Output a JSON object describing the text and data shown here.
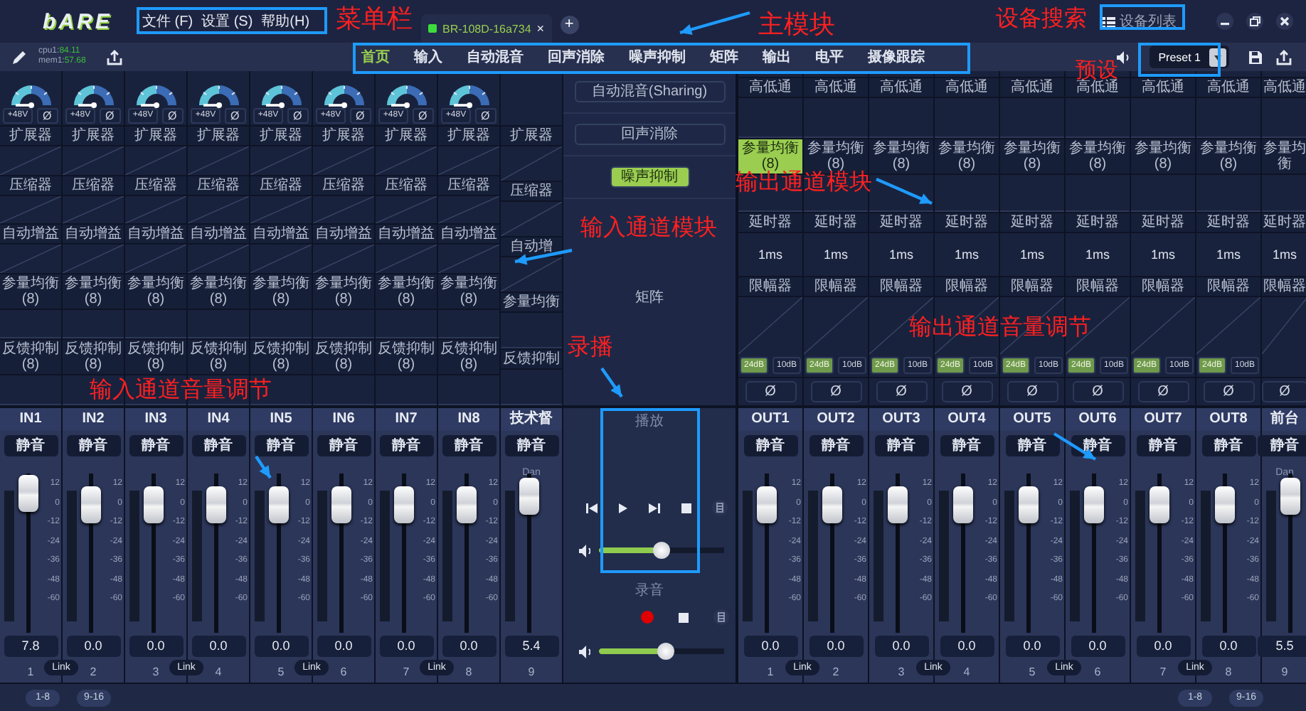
{
  "title_bar": {
    "logo": "bARE",
    "menu": [
      "文件 (F)",
      "设置 (S)",
      "帮助(H)"
    ],
    "device_tab": {
      "name": "BR-108D-16a734",
      "close": "×"
    },
    "add_tab": "+",
    "device_list": "设备列表"
  },
  "toolbar": {
    "cpu": {
      "label": "cpu1:",
      "value": "84.11"
    },
    "mem": {
      "label": "mem1:",
      "value": "57.68"
    },
    "nav": [
      {
        "label": "首页",
        "selected": true
      },
      {
        "label": "输入",
        "selected": false
      },
      {
        "label": "自动混音",
        "selected": false
      },
      {
        "label": "回声消除",
        "selected": false
      },
      {
        "label": "噪声抑制",
        "selected": false
      },
      {
        "label": "矩阵",
        "selected": false
      },
      {
        "label": "输出",
        "selected": false
      },
      {
        "label": "电平",
        "selected": false
      },
      {
        "label": "摄像跟踪",
        "selected": false
      }
    ],
    "preset": "Preset 1"
  },
  "inputs": [
    {
      "name": "IN1",
      "knob": true,
      "phantom": "+48V",
      "phantom_on": false,
      "phase": "Ø",
      "modules": [
        "扩展器",
        "压缩器",
        "自动增益",
        "参量均衡(8)",
        "反馈抑制(8)"
      ],
      "mute": "静音",
      "muted": false,
      "scale": [
        "12",
        "0",
        "-12",
        "-24",
        "-36",
        "-48",
        "-60"
      ],
      "level": 0.99,
      "value": "7.8",
      "number": "1",
      "link": "Link"
    },
    {
      "name": "IN2",
      "knob": true,
      "phantom": "+48V",
      "phantom_on": false,
      "phase": "Ø",
      "modules": [
        "扩展器",
        "压缩器",
        "自动增益",
        "参量均衡(8)",
        "反馈抑制(8)"
      ],
      "mute": "静音",
      "muted": false,
      "scale": [
        "12",
        "0",
        "-12",
        "-24",
        "-36",
        "-48",
        "-60"
      ],
      "level": 0.9,
      "value": "0.0",
      "number": "2"
    },
    {
      "name": "IN3",
      "knob": true,
      "phantom": "+48V",
      "phantom_on": false,
      "phase": "Ø",
      "modules": [
        "扩展器",
        "压缩器",
        "自动增益",
        "参量均衡(8)",
        "反馈抑制(8)"
      ],
      "mute": "静音",
      "muted": false,
      "scale": [
        "12",
        "0",
        "-12",
        "-24",
        "-36",
        "-48",
        "-60"
      ],
      "level": 0.9,
      "value": "0.0",
      "number": "3",
      "link": "Link"
    },
    {
      "name": "IN4",
      "knob": true,
      "phantom": "+48V",
      "phantom_on": false,
      "phase": "Ø",
      "modules": [
        "扩展器",
        "压缩器",
        "自动增益",
        "参量均衡(8)",
        "反馈抑制(8)"
      ],
      "mute": "静音",
      "muted": false,
      "scale": [
        "12",
        "0",
        "-12",
        "-24",
        "-36",
        "-48",
        "-60"
      ],
      "level": 0.9,
      "value": "0.0",
      "number": "4"
    },
    {
      "name": "IN5",
      "knob": true,
      "phantom": "+48V",
      "phantom_on": false,
      "phase": "Ø",
      "modules": [
        "扩展器",
        "压缩器",
        "自动增益",
        "参量均衡(8)",
        "反馈抑制(8)"
      ],
      "mute": "静音",
      "muted": false,
      "scale": [
        "12",
        "0",
        "-12",
        "-24",
        "-36",
        "-48",
        "-60"
      ],
      "level": 0.9,
      "value": "0.0",
      "number": "5",
      "link": "Link"
    },
    {
      "name": "IN6",
      "knob": true,
      "phantom": "+48V",
      "phantom_on": false,
      "phase": "Ø",
      "modules": [
        "扩展器",
        "压缩器",
        "自动增益",
        "参量均衡(8)",
        "反馈抑制(8)"
      ],
      "mute": "静音",
      "muted": false,
      "scale": [
        "12",
        "0",
        "-12",
        "-24",
        "-36",
        "-48",
        "-60"
      ],
      "level": 0.9,
      "value": "0.0",
      "number": "6"
    },
    {
      "name": "IN7",
      "knob": true,
      "phantom": "+48V",
      "phantom_on": false,
      "phase": "Ø",
      "modules": [
        "扩展器",
        "压缩器",
        "自动增益",
        "参量均衡(8)",
        "反馈抑制(8)"
      ],
      "mute": "静音",
      "muted": false,
      "scale": [
        "12",
        "0",
        "-12",
        "-24",
        "-36",
        "-48",
        "-60"
      ],
      "level": 0.9,
      "value": "0.0",
      "number": "7",
      "link": "Link"
    },
    {
      "name": "IN8",
      "knob": true,
      "phantom": "+48V",
      "phantom_on": false,
      "phase": "Ø",
      "modules": [
        "扩展器",
        "压缩器",
        "自动增益",
        "参量均衡(8)",
        "反馈抑制(8)"
      ],
      "mute": "静音",
      "muted": false,
      "scale": [
        "12",
        "0",
        "-12",
        "-24",
        "-36",
        "-48",
        "-60"
      ],
      "level": 0.9,
      "value": "0.0",
      "number": "8"
    },
    {
      "name": "技术督",
      "knob": false,
      "modules": [
        "扩展器",
        "压缩器",
        "自动增",
        "参量均衡",
        "反馈抑制"
      ],
      "mute": "静音",
      "muted": false,
      "tag": "Dan",
      "level": 0.96,
      "value": "5.4",
      "number": "9"
    }
  ],
  "center": {
    "buttons": [
      {
        "label": "自动混音(Sharing)",
        "on": false
      },
      {
        "label": "回声消除",
        "on": false
      },
      {
        "label": "噪声抑制",
        "on": true
      }
    ],
    "matrix": "矩阵",
    "playback": {
      "label": "播放",
      "level": 0.5
    },
    "record": {
      "label": "录音",
      "level": 0.53
    }
  },
  "outputs": [
    {
      "name": "OUT1",
      "modules": [
        "高低通",
        "参量均衡(8)",
        "延时器",
        "限幅器"
      ],
      "eq_on": true,
      "delay": "1ms",
      "limits": [
        {
          "label": "24dB",
          "on": true
        },
        {
          "label": "10dB",
          "on": false
        }
      ],
      "phase": "Ø",
      "mute": "静音",
      "muted": false,
      "scale": [
        "12",
        "0",
        "-12",
        "-24",
        "-36",
        "-48",
        "-60"
      ],
      "level": 0.9,
      "value": "0.0",
      "number": "1",
      "link": "Link"
    },
    {
      "name": "OUT2",
      "modules": [
        "高低通",
        "参量均衡(8)",
        "延时器",
        "限幅器"
      ],
      "eq_on": false,
      "delay": "1ms",
      "limits": [
        {
          "label": "24dB",
          "on": true
        },
        {
          "label": "10dB",
          "on": false
        }
      ],
      "phase": "Ø",
      "mute": "静音",
      "muted": false,
      "scale": [
        "12",
        "0",
        "-12",
        "-24",
        "-36",
        "-48",
        "-60"
      ],
      "level": 0.9,
      "value": "0.0",
      "number": "2"
    },
    {
      "name": "OUT3",
      "modules": [
        "高低通",
        "参量均衡(8)",
        "延时器",
        "限幅器"
      ],
      "eq_on": false,
      "delay": "1ms",
      "limits": [
        {
          "label": "24dB",
          "on": true
        },
        {
          "label": "10dB",
          "on": false
        }
      ],
      "phase": "Ø",
      "mute": "静音",
      "muted": false,
      "scale": [
        "12",
        "0",
        "-12",
        "-24",
        "-36",
        "-48",
        "-60"
      ],
      "level": 0.9,
      "value": "0.0",
      "number": "3",
      "link": "Link"
    },
    {
      "name": "OUT4",
      "modules": [
        "高低通",
        "参量均衡(8)",
        "延时器",
        "限幅器"
      ],
      "eq_on": false,
      "delay": "1ms",
      "limits": [
        {
          "label": "24dB",
          "on": true
        },
        {
          "label": "10dB",
          "on": false
        }
      ],
      "phase": "Ø",
      "mute": "静音",
      "muted": false,
      "scale": [
        "12",
        "0",
        "-12",
        "-24",
        "-36",
        "-48",
        "-60"
      ],
      "level": 0.9,
      "value": "0.0",
      "number": "4"
    },
    {
      "name": "OUT5",
      "modules": [
        "高低通",
        "参量均衡(8)",
        "延时器",
        "限幅器"
      ],
      "eq_on": false,
      "delay": "1ms",
      "limits": [
        {
          "label": "24dB",
          "on": true
        },
        {
          "label": "10dB",
          "on": false
        }
      ],
      "phase": "Ø",
      "mute": "静音",
      "muted": false,
      "scale": [
        "12",
        "0",
        "-12",
        "-24",
        "-36",
        "-48",
        "-60"
      ],
      "level": 0.9,
      "value": "0.0",
      "number": "5",
      "link": "Link"
    },
    {
      "name": "OUT6",
      "modules": [
        "高低通",
        "参量均衡(8)",
        "延时器",
        "限幅器"
      ],
      "eq_on": false,
      "delay": "1ms",
      "limits": [
        {
          "label": "24dB",
          "on": true
        },
        {
          "label": "10dB",
          "on": false
        }
      ],
      "phase": "Ø",
      "mute": "静音",
      "muted": false,
      "scale": [
        "12",
        "0",
        "-12",
        "-24",
        "-36",
        "-48",
        "-60"
      ],
      "level": 0.9,
      "value": "0.0",
      "number": "6"
    },
    {
      "name": "OUT7",
      "modules": [
        "高低通",
        "参量均衡(8)",
        "延时器",
        "限幅器"
      ],
      "eq_on": false,
      "delay": "1ms",
      "limits": [
        {
          "label": "24dB",
          "on": true
        },
        {
          "label": "10dB",
          "on": false
        }
      ],
      "phase": "Ø",
      "mute": "静音",
      "muted": false,
      "scale": [
        "12",
        "0",
        "-12",
        "-24",
        "-36",
        "-48",
        "-60"
      ],
      "level": 0.9,
      "value": "0.0",
      "number": "7",
      "link": "Link"
    },
    {
      "name": "OUT8",
      "modules": [
        "高低通",
        "参量均衡(8)",
        "延时器",
        "限幅器"
      ],
      "eq_on": false,
      "delay": "1ms",
      "limits": [
        {
          "label": "24dB",
          "on": true
        },
        {
          "label": "10dB",
          "on": false
        }
      ],
      "phase": "Ø",
      "mute": "静音",
      "muted": false,
      "scale": [
        "12",
        "0",
        "-12",
        "-24",
        "-36",
        "-48",
        "-60"
      ],
      "level": 0.9,
      "value": "0.0",
      "number": "8"
    },
    {
      "name": "前台",
      "modules": [
        "高低通",
        "参量均衡",
        "延时器",
        "限幅器"
      ],
      "eq_on": false,
      "delay": "1ms",
      "phase": "Ø",
      "mute": "静音",
      "muted": false,
      "tag": "Dan",
      "level": 0.96,
      "value": "5.5",
      "number": "9"
    }
  ],
  "bottom_bar": {
    "pages_left": [
      "1-8",
      "9-16"
    ],
    "pages_right": [
      "1-8",
      "9-16"
    ]
  },
  "annotations": [
    {
      "text": "菜单栏"
    },
    {
      "text": "主模块"
    },
    {
      "text": "设备搜索"
    },
    {
      "text": "预设"
    },
    {
      "text": "输入通道模块"
    },
    {
      "text": "输出通道模块"
    },
    {
      "text": "录播"
    },
    {
      "text": "输入通道音量调节"
    },
    {
      "text": "输出通道音量调节"
    }
  ]
}
